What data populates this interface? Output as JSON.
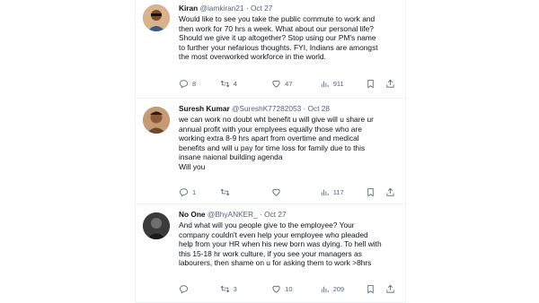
{
  "tweets": [
    {
      "name": "Kiran",
      "handle": "@iamkiran21",
      "dot": "·",
      "date": "Oct 27",
      "lines": [
        "Would like to see you take the public commute to work and",
        "then work for 70 hrs a week. What about our personal life?",
        "Should we give it up altogether? Stop using our PM's name",
        "to further your nefarious thoughts. FYI, Indians are amongst",
        "the most overworked workforce in the world."
      ],
      "replies": "8",
      "retweets": "4",
      "likes": "47",
      "views": "911"
    },
    {
      "name": "Suresh Kumar",
      "handle": "@SureshK77282053",
      "dot": "·",
      "date": "Oct 28",
      "lines": [
        "we can work no doubt wht benefit u will give will u share ur",
        "annual profit with your emplyees equally those who are",
        "working extra 8-9 hrs apart from overtime and medical",
        "benefits and will u pay for time loss for family due to this",
        "insane naional building agenda",
        "Will you"
      ],
      "replies": "1",
      "retweets": "",
      "likes": "",
      "views": "117"
    },
    {
      "name": "No One",
      "handle": "@BhyANKER_",
      "dot": "·",
      "date": "Oct 27",
      "lines": [
        "And what will you people give to the employee? Your",
        "company couldn't even help your employee who pleaded",
        "help from your HR when his new born was dying. To hell with",
        "this 15-18 hr work culture, if you see your managers as",
        "labourers, then shame on u for asking them to work >8hrs"
      ],
      "replies": "",
      "retweets": "3",
      "likes": "10",
      "views": "209"
    }
  ],
  "icons": {
    "reply": "reply-icon",
    "retweet": "retweet-icon",
    "like": "heart-icon",
    "views": "views-icon",
    "bookmark": "bookmark-icon",
    "share": "share-icon"
  },
  "colors": {
    "text": "#0f1419",
    "muted": "#536471",
    "border": "#eff3f4"
  }
}
